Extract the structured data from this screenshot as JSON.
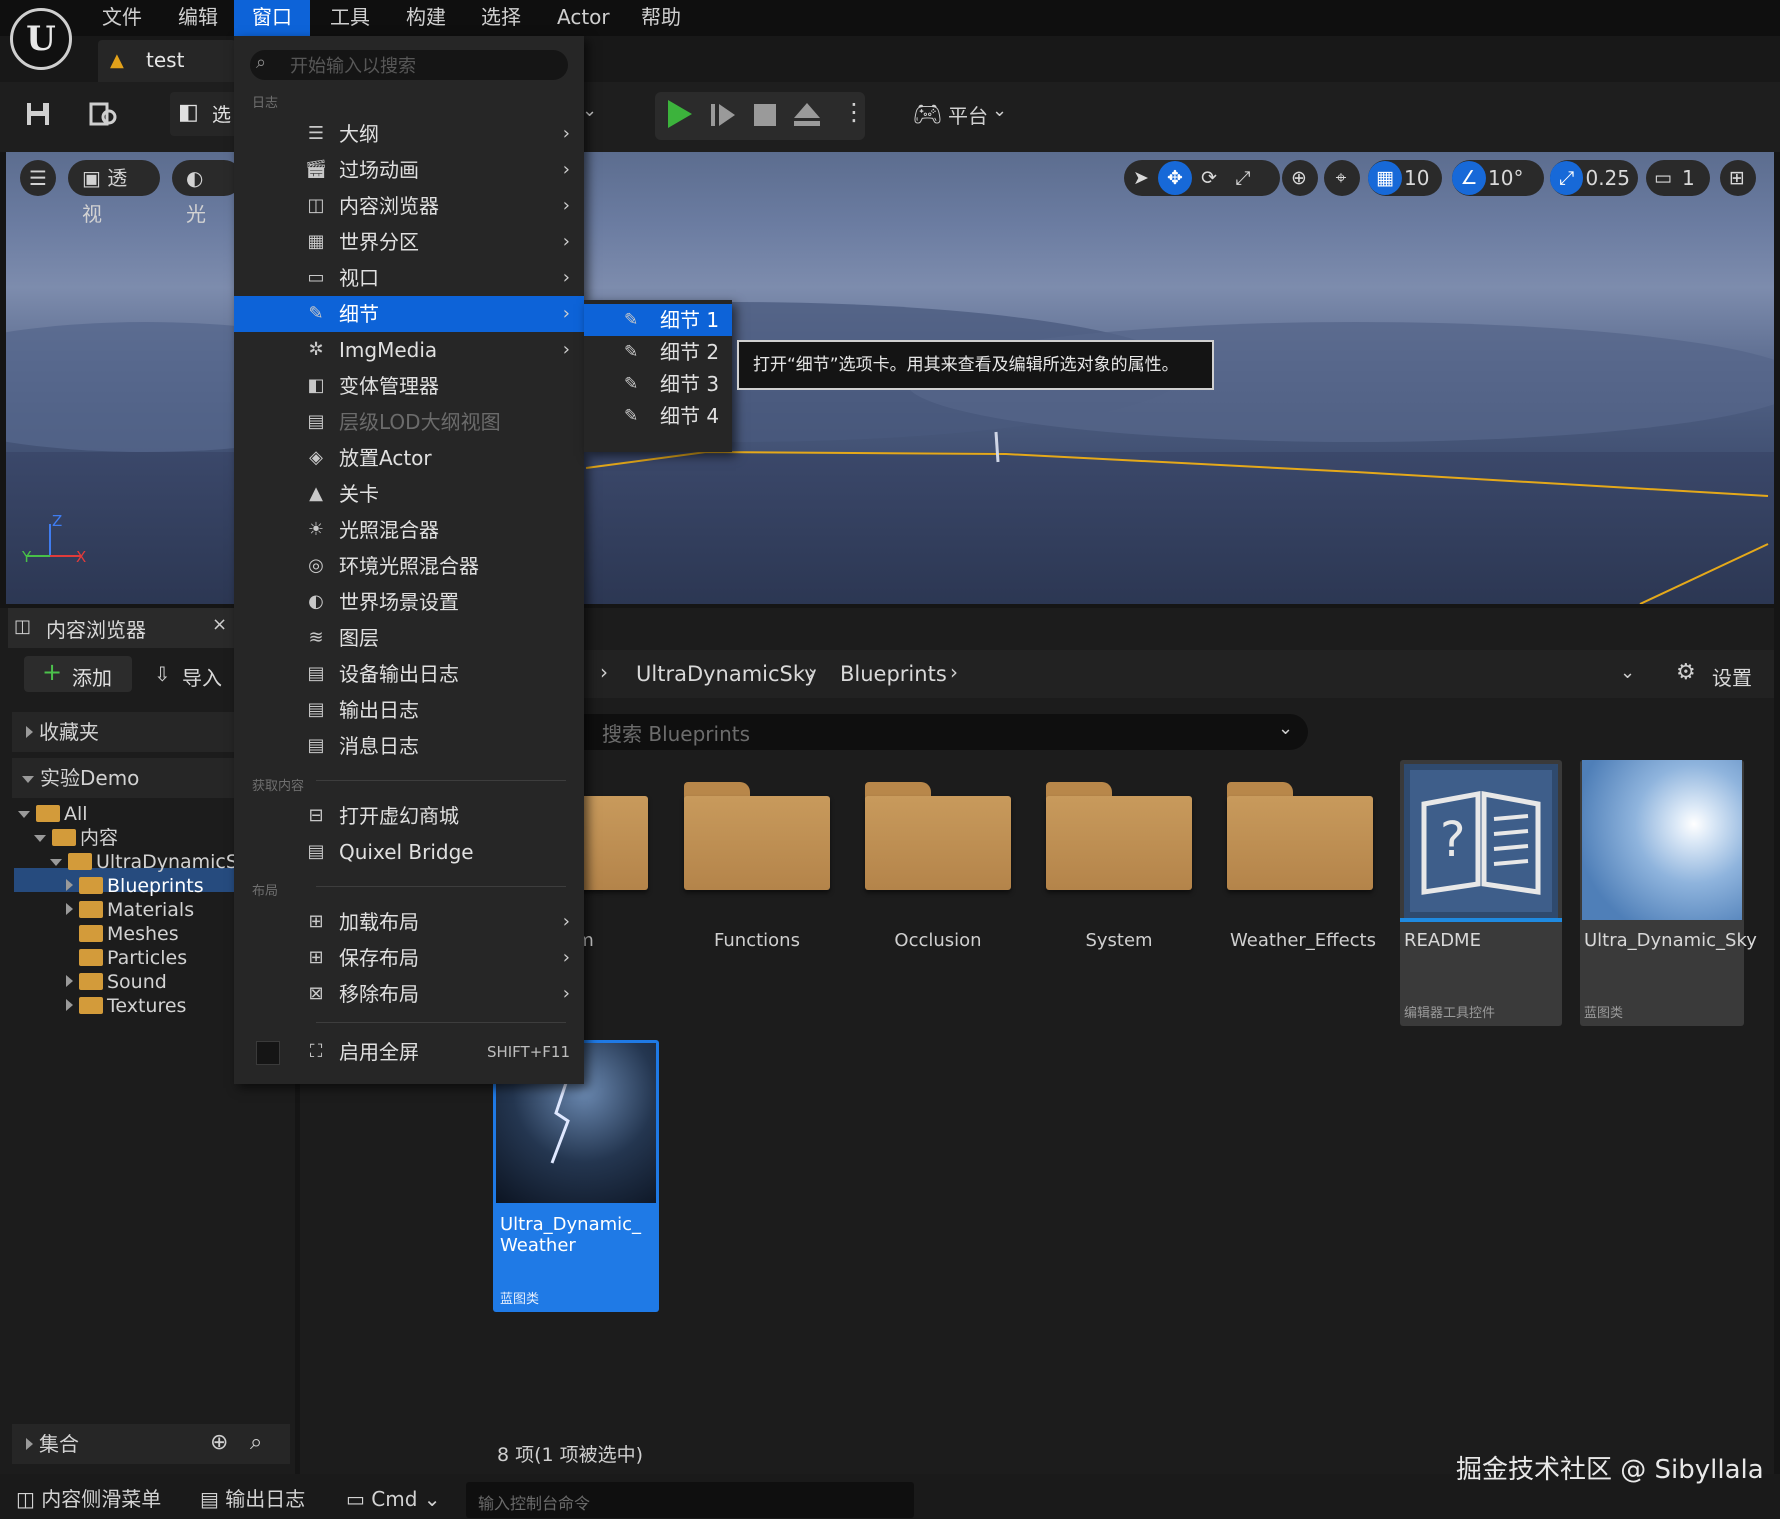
{
  "menubar": {
    "items": [
      "文件",
      "编辑",
      "窗口",
      "工具",
      "构建",
      "选择",
      "Actor",
      "帮助"
    ],
    "active": "窗口"
  },
  "document_tab": {
    "label": "test"
  },
  "toolbar": {
    "select_mode_label": "选",
    "platform_label": "平台"
  },
  "viewport": {
    "perspective_label": "透视",
    "lighting_label": "光",
    "grid_size": "10",
    "rotation_snap": "10°",
    "scale_snap": "0.25",
    "camera_speed": "1",
    "axis": {
      "z": "Z",
      "y": "Y",
      "x": "X"
    }
  },
  "window_menu": {
    "search_placeholder": "开始输入以搜索",
    "section_log": "日志",
    "items_top": [
      {
        "label": "大纲",
        "icon": "outliner-icon",
        "submenu": true
      },
      {
        "label": "过场动画",
        "icon": "cinematics-icon",
        "submenu": true
      },
      {
        "label": "内容浏览器",
        "icon": "content-browser-icon",
        "submenu": true
      },
      {
        "label": "世界分区",
        "icon": "world-partition-icon",
        "submenu": true
      },
      {
        "label": "视口",
        "icon": "viewport-icon",
        "submenu": true
      },
      {
        "label": "细节",
        "icon": "details-icon",
        "submenu": true,
        "highlighted": true
      },
      {
        "label": "ImgMedia",
        "icon": "imgmedia-icon",
        "submenu": true
      },
      {
        "label": "变体管理器",
        "icon": "variant-manager-icon",
        "submenu": false
      },
      {
        "label": "层级LOD大纲视图",
        "icon": "hlod-icon",
        "submenu": false,
        "disabled": true
      },
      {
        "label": "放置Actor",
        "icon": "place-actor-icon",
        "submenu": false
      },
      {
        "label": "关卡",
        "icon": "levels-icon",
        "submenu": false
      },
      {
        "label": "光照混合器",
        "icon": "light-mixer-icon",
        "submenu": false
      },
      {
        "label": "环境光照混合器",
        "icon": "env-light-mixer-icon",
        "submenu": false
      },
      {
        "label": "世界场景设置",
        "icon": "world-settings-icon",
        "submenu": false
      },
      {
        "label": "图层",
        "icon": "layers-icon",
        "submenu": false
      },
      {
        "label": "设备输出日志",
        "icon": "device-log-icon",
        "submenu": false
      },
      {
        "label": "输出日志",
        "icon": "output-log-icon",
        "submenu": false
      },
      {
        "label": "消息日志",
        "icon": "message-log-icon",
        "submenu": false
      }
    ],
    "section_get_content": "获取内容",
    "items_content": [
      {
        "label": "打开虚幻商城",
        "icon": "marketplace-icon"
      },
      {
        "label": "Quixel Bridge",
        "icon": "quixel-icon"
      }
    ],
    "section_layout": "布局",
    "items_layout": [
      {
        "label": "加载布局",
        "icon": "load-layout-icon"
      },
      {
        "label": "保存布局",
        "icon": "save-layout-icon"
      },
      {
        "label": "移除布局",
        "icon": "remove-layout-icon"
      }
    ],
    "fullscreen": {
      "label": "启用全屏",
      "shortcut": "SHIFT+F11"
    }
  },
  "details_submenu": {
    "items": [
      "细节 1",
      "细节 2",
      "细节 3",
      "细节 4"
    ],
    "highlighted_index": 0
  },
  "tooltip": {
    "text": "打开“细节”选项卡。用其来查看及编辑所选对象的属性。"
  },
  "content_browser": {
    "tab_label": "内容浏览器",
    "add_label": "添加",
    "import_label": "导入",
    "favorites_label": "收藏夹",
    "project_label": "实验Demo",
    "tree": [
      {
        "label": "All",
        "depth": 0,
        "expanded": true
      },
      {
        "label": "内容",
        "depth": 1,
        "expanded": true
      },
      {
        "label": "UltraDynamicSky",
        "depth": 2,
        "expanded": true
      },
      {
        "label": "Blueprints",
        "depth": 3,
        "selected": true
      },
      {
        "label": "Materials",
        "depth": 3
      },
      {
        "label": "Meshes",
        "depth": 3
      },
      {
        "label": "Particles",
        "depth": 3
      },
      {
        "label": "Sound",
        "depth": 3
      },
      {
        "label": "Textures",
        "depth": 3
      }
    ],
    "collections_label": "集合",
    "breadcrumb": [
      "UltraDynamicSky",
      "Blueprints"
    ],
    "settings_label": "设置",
    "search_placeholder": "搜索 Blueprints",
    "assets": [
      {
        "name": "m",
        "kind": "folder"
      },
      {
        "name": "Functions",
        "kind": "folder"
      },
      {
        "name": "Occlusion",
        "kind": "folder"
      },
      {
        "name": "System",
        "kind": "folder"
      },
      {
        "name": "Weather_Effects",
        "kind": "folder"
      },
      {
        "name": "README",
        "kind": "asset",
        "type": "编辑器工具控件"
      },
      {
        "name": "Ultra_Dynamic_Sky",
        "kind": "asset",
        "type": "蓝图类"
      },
      {
        "name": "Ultra_Dynamic_ Weather",
        "kind": "asset",
        "type": "蓝图类",
        "selected": true
      }
    ],
    "item_count": "8 项(1 项被选中)"
  },
  "statusbar": {
    "content_drawer": "内容侧滑菜单",
    "output_log": "输出日志",
    "cmd": "Cmd",
    "console_placeholder": "输入控制台命令"
  },
  "watermark": "掘金技术社区 @ Sibyllala",
  "colors": {
    "accent": "#0d63d8",
    "folder": "#c89a5c",
    "play": "#3cb33c"
  }
}
